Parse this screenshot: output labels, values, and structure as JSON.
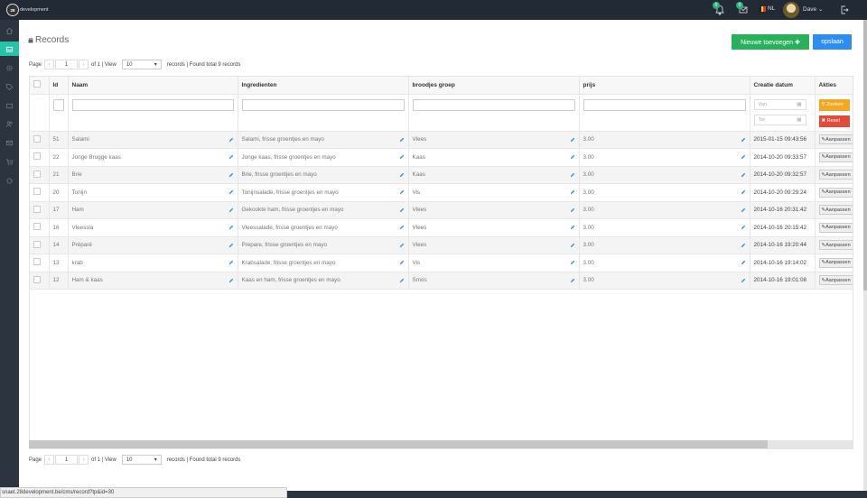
{
  "brand": {
    "logo_mark": "28",
    "logo_text": "development"
  },
  "topbar": {
    "notif1_count": "0",
    "notif2_count": "0",
    "lang": "NL",
    "user": "Dave ⌄"
  },
  "sidebar": {
    "items": [
      "home-icon",
      "inbox-icon",
      "settings-icon",
      "tag-icon",
      "mail-icon",
      "users-icon",
      "envelope-icon",
      "cart-icon",
      "gear-icon"
    ],
    "active_index": 1
  },
  "page": {
    "title": "Records",
    "new_button": "Nieuwe toevoegen ✚",
    "save_button": "opslaan"
  },
  "pager": {
    "label_page": "Page",
    "prev": "‹",
    "current": "1",
    "next": "›",
    "of_text": "of 1 | View",
    "per_page": "10",
    "summary": "records | Found total 9 records"
  },
  "table": {
    "headers": {
      "id": "Id",
      "naam": "Naam",
      "ingredienten": "Ingredienten",
      "groep": "broodjes groep",
      "prijs": "prijs",
      "datum": "Creatie datum",
      "akties": "Akties"
    },
    "filter": {
      "van": "Van",
      "tot": "Tot",
      "zoeken": "Zoeken",
      "reset": "Reset"
    },
    "edit_label": "Aanpassen",
    "rows": [
      {
        "id": "51",
        "naam": "Salami",
        "ingredienten": "Salami, frisse groentjes en mayo",
        "groep": "Vlees",
        "prijs": "3.00",
        "datum": "2015-01-15 09:43:56"
      },
      {
        "id": "22",
        "naam": "Jonge Brugge kaas",
        "ingredienten": "Jonge kaas, frisse groentjes en mayo",
        "groep": "Kaas",
        "prijs": "3.00",
        "datum": "2014-10-20 09:33:57"
      },
      {
        "id": "21",
        "naam": "Brie",
        "ingredienten": "Brie, frisse groentjes en mayo",
        "groep": "Kaas",
        "prijs": "3.00",
        "datum": "2014-10-20 09:32:57"
      },
      {
        "id": "20",
        "naam": "Tonijn",
        "ingredienten": "Tonijnsalade, frisse groentjes en mayo",
        "groep": "Vis",
        "prijs": "3.00",
        "datum": "2014-10-20 09:29:24"
      },
      {
        "id": "17",
        "naam": "Ham",
        "ingredienten": "Gekookte ham, frisse groentjes en mayo",
        "groep": "Vlees",
        "prijs": "3.00",
        "datum": "2014-10-16 20:31:42"
      },
      {
        "id": "16",
        "naam": "Vleessla",
        "ingredienten": "Vleessalade, frisse groentjes en mayo",
        "groep": "Vlees",
        "prijs": "3.00",
        "datum": "2014-10-16 20:15:42"
      },
      {
        "id": "14",
        "naam": "Préparé",
        "ingredienten": "Prepare, frisse groentjes en mayo",
        "groep": "Vlees",
        "prijs": "3.00",
        "datum": "2014-10-16 19:20:44"
      },
      {
        "id": "13",
        "naam": "krab",
        "ingredienten": "Krabsalade, frisse groentjes en mayo",
        "groep": "Vis",
        "prijs": "3.00",
        "datum": "2014-10-16 19:14:02"
      },
      {
        "id": "12",
        "naam": "Ham & kaas",
        "ingredienten": "Kaas en ham, frisse groentjes en mayo",
        "groep": "Smos",
        "prijs": "3.00",
        "datum": "2014-10-16 19:01:08"
      }
    ]
  },
  "status_url": "snaet.28development.be/cms/record?tp&id=30",
  "colors": {
    "accent": "#27c3a9",
    "green": "#2ab05a",
    "blue": "#2d8ef0",
    "orange": "#f5a623",
    "red": "#e04b3c",
    "pencil": "#3a8fd6"
  }
}
